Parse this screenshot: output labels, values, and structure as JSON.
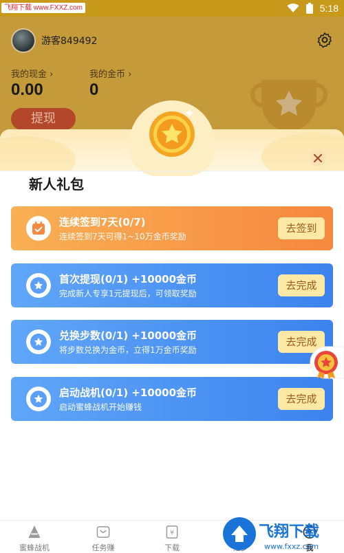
{
  "status_bar": {
    "watermark": "飞翔下载 www.FXXZ.com",
    "time": "5:18"
  },
  "profile": {
    "username": "游客849492",
    "cash_label": "我的现金",
    "cash_value": "0.00",
    "coin_label": "我的金币",
    "coin_value": "0",
    "withdraw_label": "提现"
  },
  "modal": {
    "title": "新人礼包",
    "tasks": [
      {
        "title": "连续签到7天(0/7)",
        "subtitle": "连续签到7天可得1~10万金币奖励",
        "button": "去签到",
        "style": "orange",
        "icon": "calendar-check-icon"
      },
      {
        "title": "首次提现(0/1) +10000金币",
        "subtitle": "完成新人专享1元提现后，可领取奖励",
        "button": "去完成",
        "style": "blue",
        "icon": "star-badge-icon"
      },
      {
        "title": "兑换步数(0/1) +10000金币",
        "subtitle": "将步数兑换为金币，立得1万金币奖励",
        "button": "去完成",
        "style": "blue",
        "icon": "star-badge-icon"
      },
      {
        "title": "启动战机(0/1) +10000金币",
        "subtitle": "启动蜜蜂战机开始赚钱",
        "button": "去完成",
        "style": "blue",
        "icon": "star-badge-icon"
      }
    ]
  },
  "bottom_nav": {
    "items": [
      {
        "label": "蜜蜂战机",
        "icon": "bee-plane-icon"
      },
      {
        "label": "任务赚",
        "icon": "task-icon"
      },
      {
        "label": "下载",
        "icon": "download-icon"
      },
      {
        "label": "走步",
        "icon": "walk-icon"
      },
      {
        "label": "我",
        "icon": "profile-icon"
      }
    ]
  },
  "watermark_logo": "飞翔下载 www.fxxz.com",
  "colors": {
    "orange_card": "#f6883f",
    "blue_card": "#3d83ee",
    "task_button_bg": "#fde8a6",
    "header_bg": "#c49a3b"
  }
}
